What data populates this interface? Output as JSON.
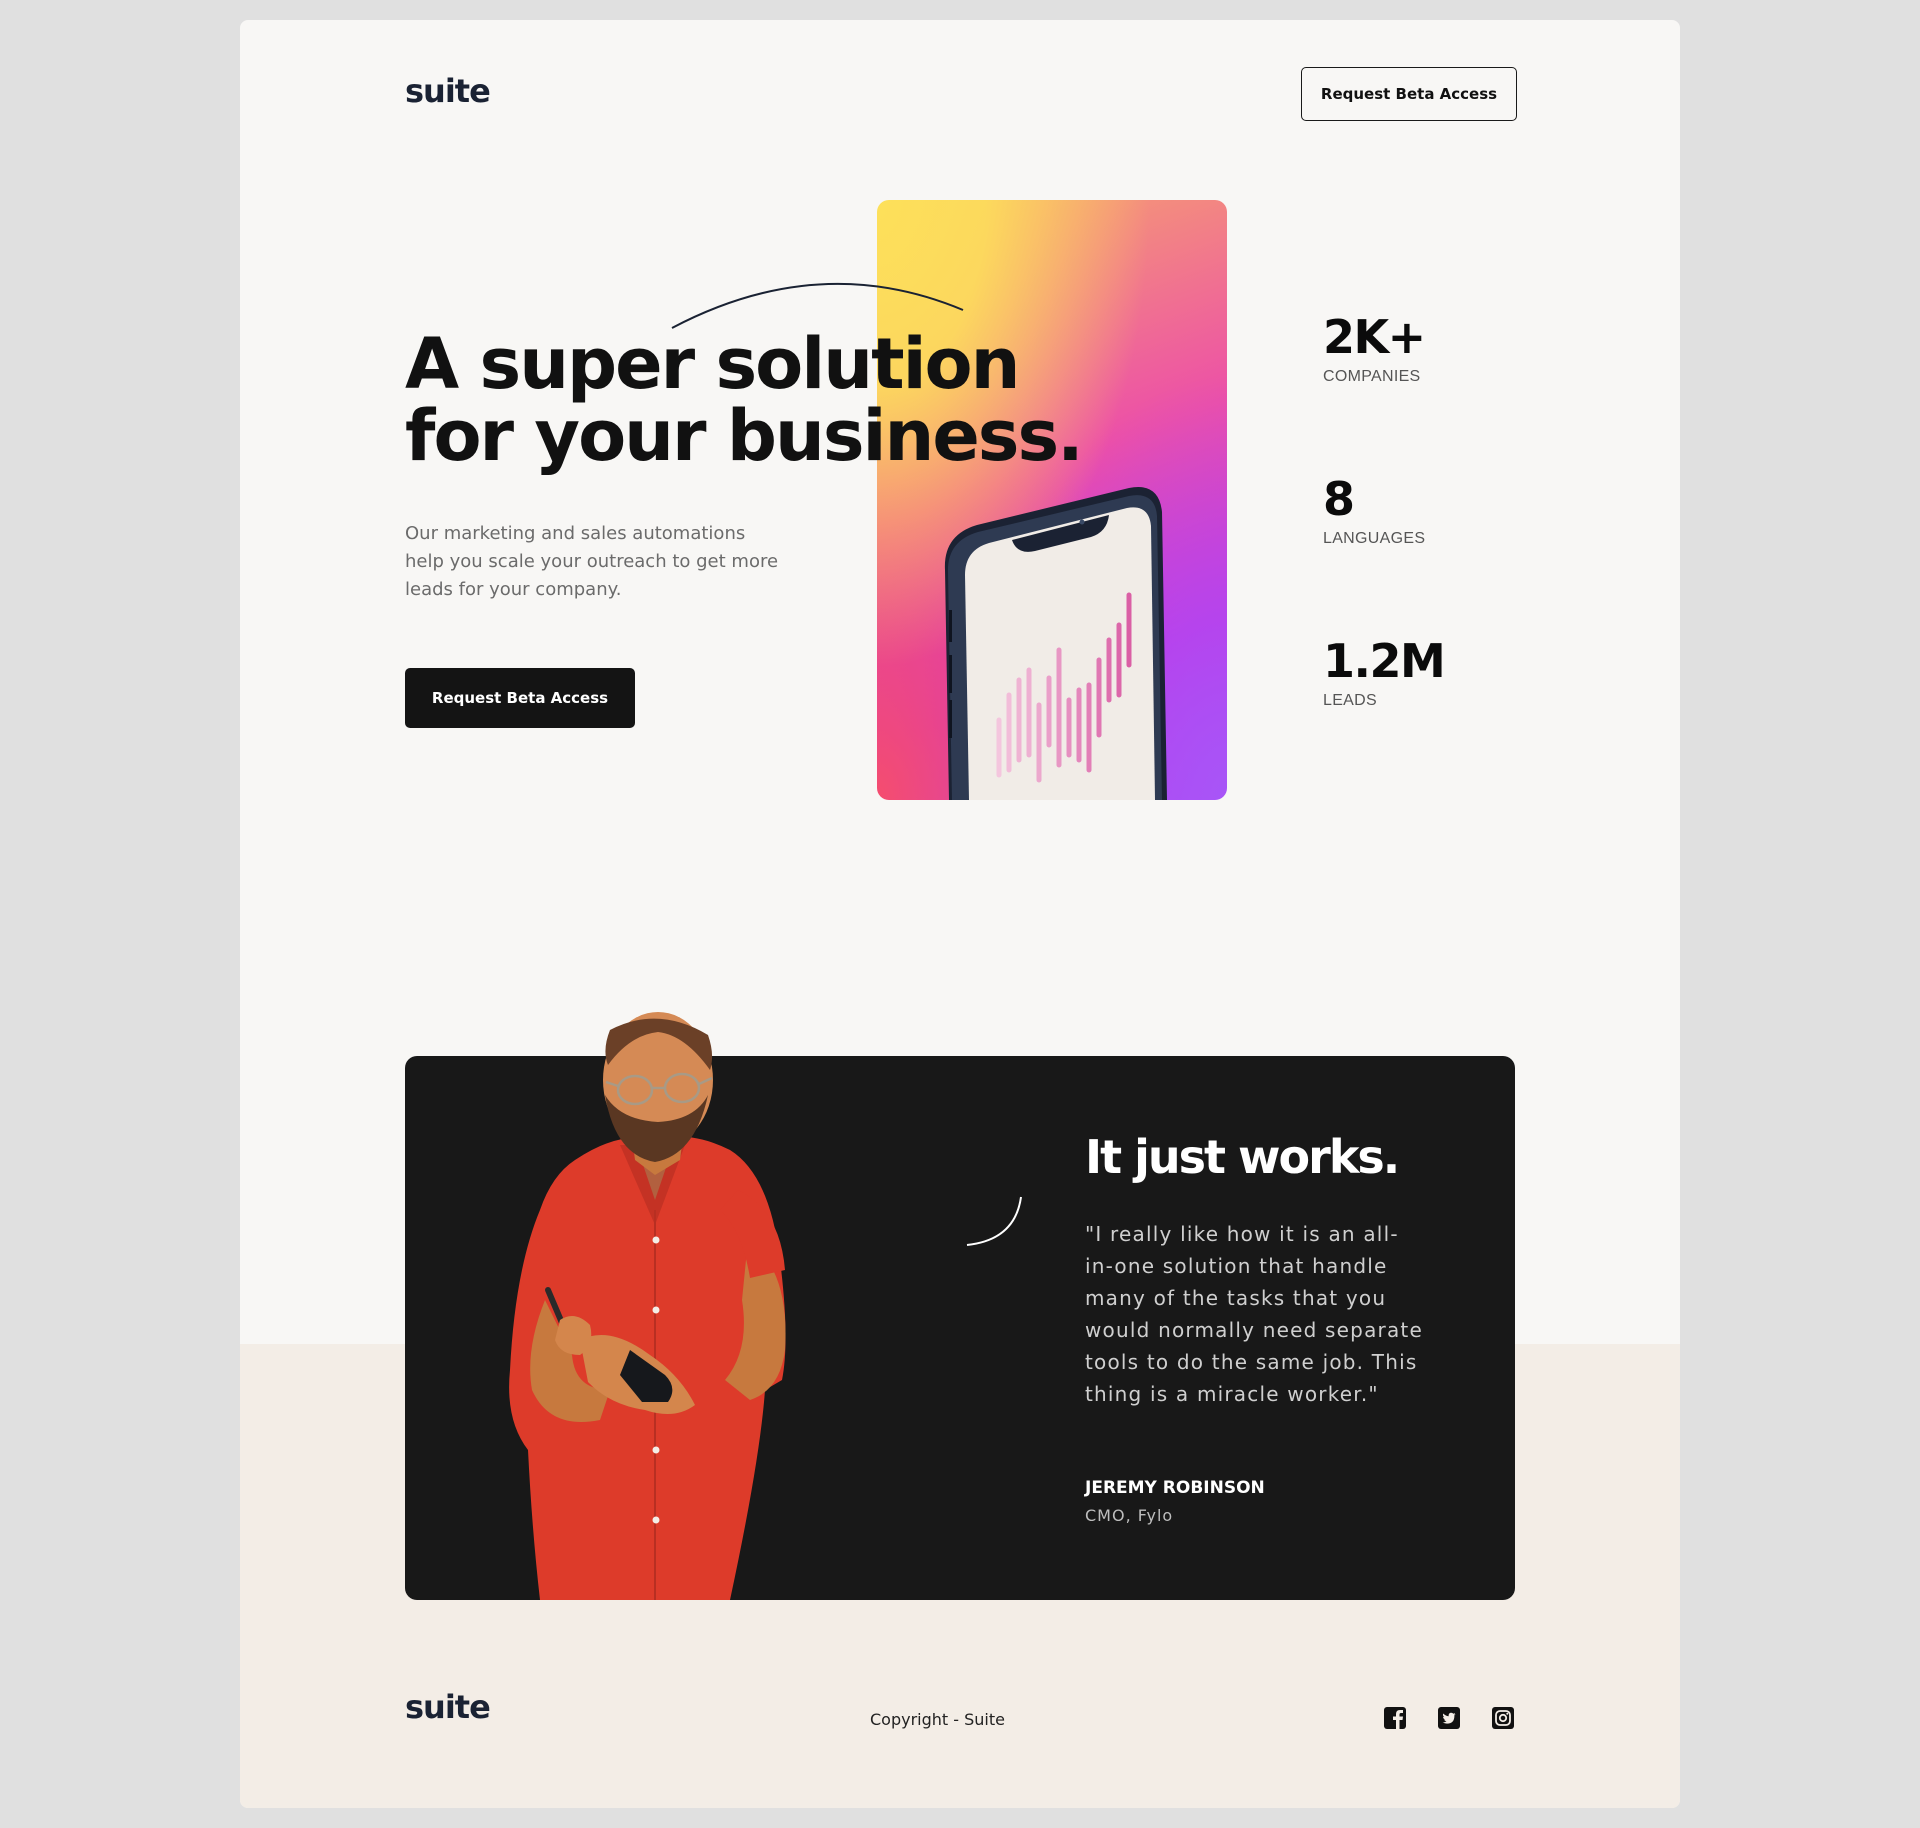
{
  "header": {
    "logo": "suite",
    "cta_label": "Request Beta Access"
  },
  "hero": {
    "title_light_1": "A ",
    "title_bold_1": "super solution",
    "title_light_2": "for your ",
    "title_bold_2": "business.",
    "description": "Our marketing and sales automations help you scale your outreach to get more leads for your company.",
    "cta_label": "Request Beta Access"
  },
  "stats": [
    {
      "value": "2K+",
      "label": "COMPANIES"
    },
    {
      "value": "8",
      "label": "LANGUAGES"
    },
    {
      "value": "1.2M",
      "label": "LEADS"
    }
  ],
  "testimonial": {
    "title_light": "It just ",
    "title_bold": "works.",
    "quote": "\"I really like how it is an all-in-one solution that handle many of the tasks that you would normally need separate tools to do the same job. This thing is a miracle worker.\"",
    "name": "JEREMY ROBINSON",
    "role": "CMO, Fylo"
  },
  "footer": {
    "logo": "suite",
    "copyright": "Copyright - Suite",
    "socials": [
      "facebook-icon",
      "twitter-icon",
      "instagram-icon"
    ]
  },
  "colors": {
    "page_bg": "#e0e0e0",
    "card_bg": "#f8f7f5",
    "lower_band": "#f3ede6",
    "dark": "#181818",
    "shirt": "#dd3b2a",
    "gradient_yellow": "#fde05a",
    "gradient_pink": "#ec4fa8",
    "gradient_purple": "#a855f7"
  }
}
